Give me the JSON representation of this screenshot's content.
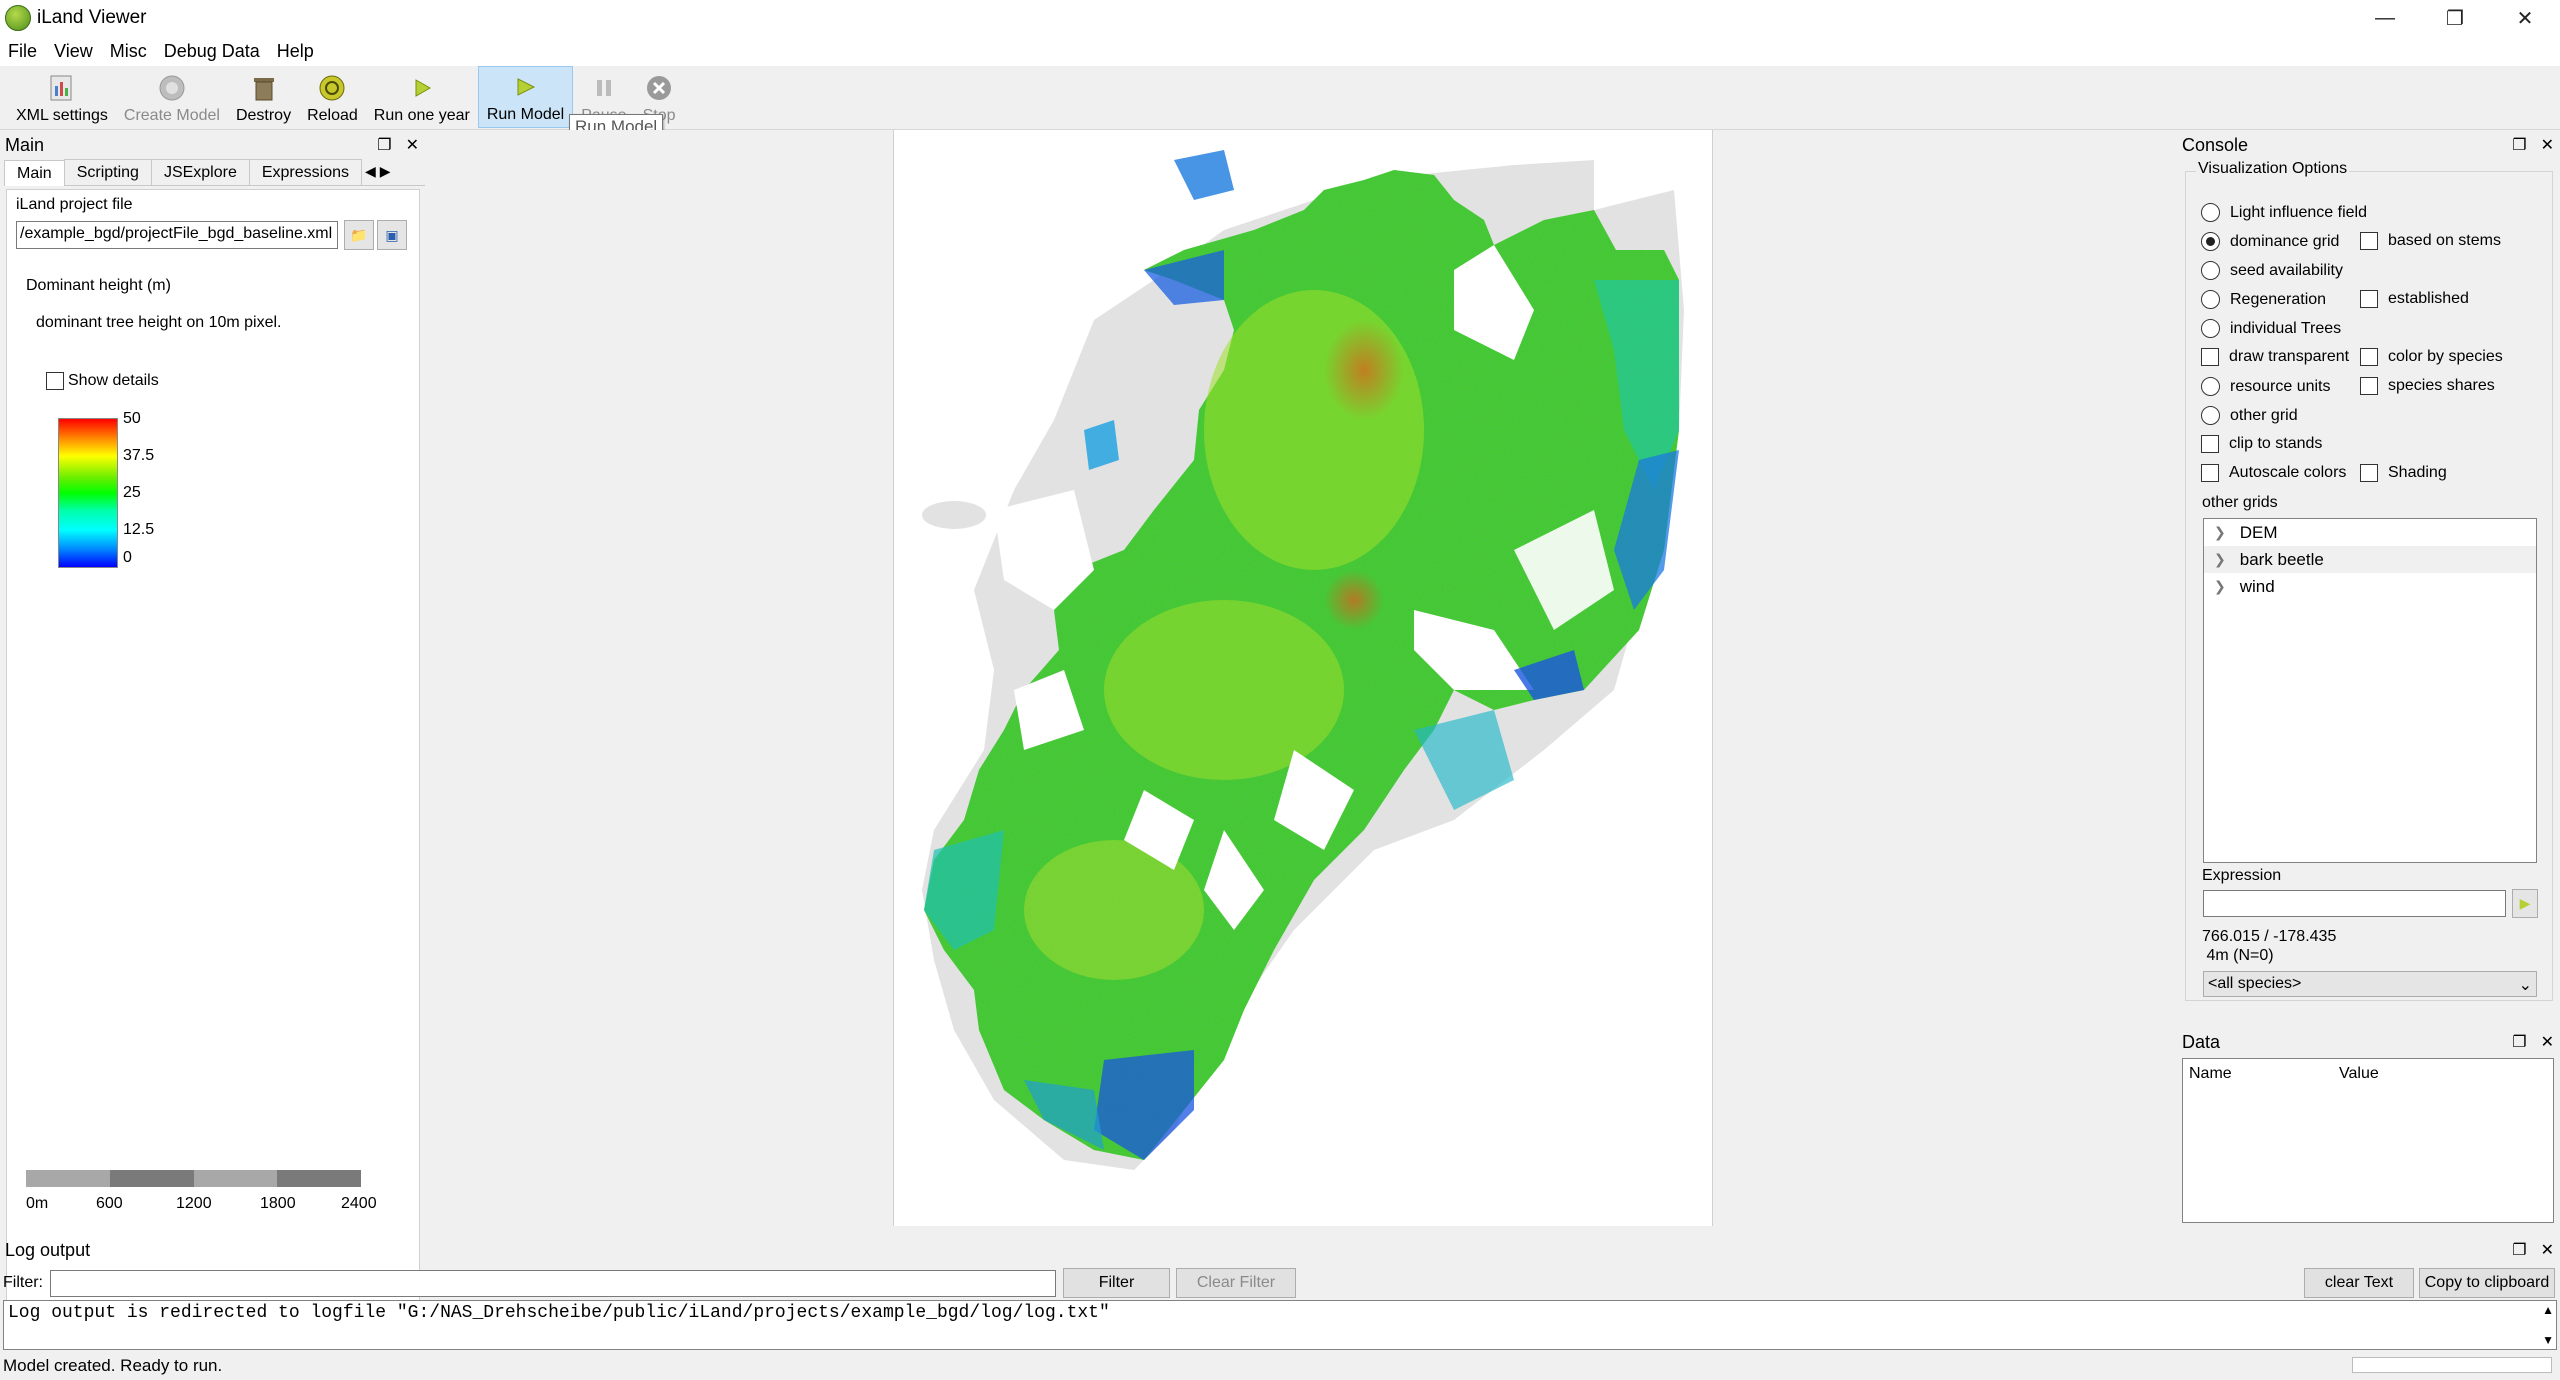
{
  "window": {
    "title": "iLand Viewer"
  },
  "menu": [
    "File",
    "View",
    "Misc",
    "Debug Data",
    "Help"
  ],
  "toolbar": {
    "buttons": [
      {
        "label": "XML settings",
        "icon": "xml-settings-icon",
        "state": "normal"
      },
      {
        "label": "Create Model",
        "icon": "create-model-icon",
        "state": "disabled"
      },
      {
        "label": "Destroy",
        "icon": "destroy-icon",
        "state": "normal"
      },
      {
        "label": "Reload",
        "icon": "reload-icon",
        "state": "normal"
      },
      {
        "label": "Run one year",
        "icon": "run-year-icon",
        "state": "normal"
      },
      {
        "label": "Run Model",
        "icon": "run-model-icon",
        "state": "active"
      },
      {
        "label": "Pause",
        "icon": "pause-icon",
        "state": "disabled"
      },
      {
        "label": "Stop",
        "icon": "stop-icon",
        "state": "disabled"
      }
    ],
    "tooltip": "Run Model"
  },
  "main_dock": {
    "title": "Main",
    "tabs": [
      "Main",
      "Scripting",
      "JSExplore",
      "Expressions"
    ],
    "project_label": "iLand project file",
    "project_value": "/example_bgd/projectFile_bgd_baseline.xml",
    "layer_title": "Dominant height (m)",
    "layer_desc": "dominant tree height on 10m pixel.",
    "show_details": "Show details",
    "legend": [
      "50",
      "37.5",
      "25",
      "12.5",
      "0"
    ],
    "scale": [
      "0m",
      "600",
      "1200",
      "1800",
      "2400"
    ]
  },
  "console": {
    "title": "Console",
    "group": "Visualization Options",
    "options": {
      "light": "Light influence field",
      "dominance": "dominance grid",
      "seed": "seed availability",
      "regen": "Regeneration",
      "individual": "individual Trees",
      "draw_transparent": "draw transparent",
      "resource": "resource units",
      "other_grid": "other grid",
      "clip": "clip to stands",
      "autoscale": "Autoscale colors",
      "based_on_stems": "based on stems",
      "established": "established",
      "color_by_species": "color by species",
      "species_shares": "species shares",
      "shading": "Shading"
    },
    "other_grids_label": "other grids",
    "other_grids": [
      "DEM",
      "bark beetle",
      "wind"
    ],
    "expression_label": "Expression",
    "coords": "766.015 / -178.435",
    "coords_sub": " 4m (N=0)",
    "species_select": "<all species>"
  },
  "data_dock": {
    "title": "Data",
    "columns": [
      "Name",
      "Value"
    ]
  },
  "log": {
    "title": "Log output",
    "filter_label": "Filter:",
    "filter_btn": "Filter",
    "clear_filter_btn": "Clear Filter",
    "clear_text_btn": "clear Text",
    "copy_btn": "Copy to clipboard",
    "text": "Log output is redirected to logfile \"G:/NAS_Drehscheibe/public/iLand/projects/example_bgd/log/log.txt\""
  },
  "status": "Model created. Ready to run.",
  "colors": {
    "accent": "#cce4f7",
    "forest_green": "#3fd32a",
    "forest_blue": "#1a4fe0",
    "forest_red": "#e0401a"
  }
}
